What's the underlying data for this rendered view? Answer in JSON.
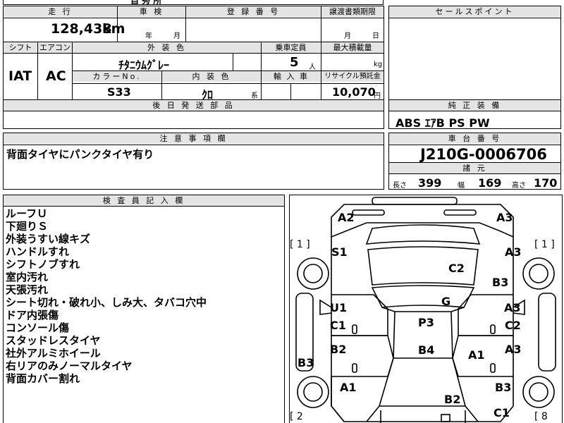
{
  "top_strip": {
    "partial_text": "自 秀 所"
  },
  "mileage": {
    "header": "走 行",
    "value": "128,438",
    "unit": "km"
  },
  "inspection": {
    "header": "車 検",
    "year_unit": "年",
    "month_unit": "月"
  },
  "registration": {
    "header": "登 録 番 号"
  },
  "transfer_deadline": {
    "header": "譲渡書類期限",
    "month_unit": "月",
    "day_unit": "日"
  },
  "sales_points": {
    "header": "セールスポイント"
  },
  "shift": {
    "header": "シフト",
    "value": "IAT"
  },
  "aircon": {
    "header": "エアコン",
    "value": "AC"
  },
  "exterior_color": {
    "header": "外 装 色",
    "value": "ﾁﾀﾆｳﾑｸﾞﾚｰ"
  },
  "capacity": {
    "header": "乗車定員",
    "value": "5",
    "unit": "人"
  },
  "max_load": {
    "header": "最大積載量",
    "unit": "kg"
  },
  "color_no": {
    "header": "カラーNo.",
    "value": "S33"
  },
  "interior_color": {
    "header": "内 装 色",
    "value": "ｸﾛ",
    "unit": "系"
  },
  "import": {
    "header": "輸 入 車"
  },
  "recycle": {
    "header": "リサイクル預託金",
    "value": "10,070",
    "unit": "円"
  },
  "later_parts": {
    "header": "後 日 発 送 部 品"
  },
  "standard_equipment": {
    "header": "純 正 装 備",
    "value": "ABS ｴｱB PS PW"
  },
  "caution": {
    "header": "注 意 事 項 欄",
    "text": "背面タイヤにパンクタイヤ有り"
  },
  "chassis": {
    "header": "車 台 番 号",
    "value": "J210G-0006706"
  },
  "specs": {
    "header": "諸 元",
    "length_label": "長さ",
    "length": "399",
    "width_label": "幅",
    "width": "169",
    "height_label": "高さ",
    "height": "170"
  },
  "inspector": {
    "header": "検 査 員 記 入 欄",
    "notes": [
      "ルーフＵ",
      "下廻りＳ",
      "外装うすい線キズ",
      "ハンドルすれ",
      "シフトノブすれ",
      "室内汚れ",
      "天張汚れ",
      "シート切れ・破れ小、しみ大、タバコ穴中",
      "ドア内張傷",
      "コンソール傷",
      "スタッドレスタイヤ",
      "社外アルミホイール",
      "右リアのみノーマルタイヤ",
      "背面カバー割れ"
    ]
  },
  "diagram": {
    "side_tags": {
      "left_top": "[ 1 ]",
      "right_top": "[ 1 ]",
      "left_bottom": "[ 2",
      "right_bottom": "[ 8"
    },
    "labels": {
      "a2": "A2",
      "a3_top": "A3",
      "s1": "S1",
      "a3_right": "A3",
      "c2_top": "C2",
      "b3_right": "B3",
      "g": "G",
      "u1": "U1",
      "a3_mid": "A3",
      "c1_left": "C1",
      "p3": "P3",
      "c2_right": "C2",
      "b2_left": "B2",
      "b4": "B4",
      "a1_center": "A1",
      "a3_low": "A3",
      "b3_left": "B3",
      "a1_left": "A1",
      "b3_bottom": "B3",
      "b2_bottom": "B2",
      "c1_bottom": "C1"
    }
  }
}
